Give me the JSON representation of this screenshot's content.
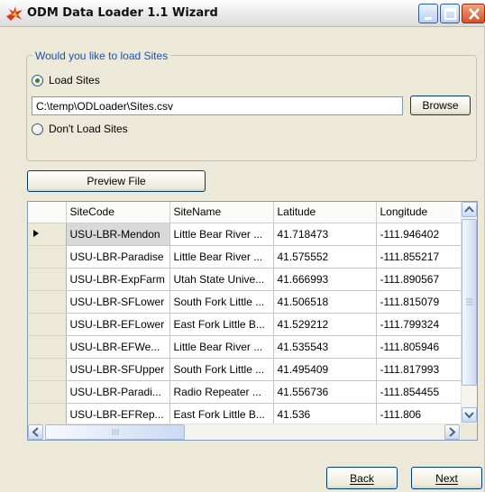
{
  "window": {
    "title": "ODM Data Loader 1.1 Wizard"
  },
  "group": {
    "legend": "Would you like to load Sites",
    "load_option": "Load Sites",
    "file_path": "C:\\temp\\ODLoader\\Sites.csv",
    "browse_label": "Browse",
    "dont_load_option": "Don't Load Sites"
  },
  "preview_label": "Preview File",
  "grid": {
    "columns": [
      "SiteCode",
      "SiteName",
      "Latitude",
      "Longitude"
    ],
    "rows": [
      [
        "USU-LBR-Mendon",
        "Little Bear River ...",
        "41.718473",
        "-111.946402"
      ],
      [
        "USU-LBR-Paradise",
        "Little Bear River ...",
        "41.575552",
        "-111.855217"
      ],
      [
        "USU-LBR-ExpFarm",
        "Utah State Unive...",
        "41.666993",
        "-111.890567"
      ],
      [
        "USU-LBR-SFLower",
        "South Fork Little ...",
        "41.506518",
        "-111.815079"
      ],
      [
        "USU-LBR-EFLower",
        "East Fork Little B...",
        "41.529212",
        "-111.799324"
      ],
      [
        "USU-LBR-EFWe...",
        "Little Bear River ...",
        "41.535543",
        "-111.805946"
      ],
      [
        "USU-LBR-SFUpper",
        "South Fork Little ...",
        "41.495409",
        "-111.817993"
      ],
      [
        "USU-LBR-Paradi...",
        "Radio Repeater ...",
        "41.556736",
        "-111.854455"
      ],
      [
        "USU-LBR-EFRep...",
        "East Fork Little B...",
        "41.536",
        "-111.806"
      ]
    ]
  },
  "nav": {
    "back_label": "Back",
    "next_label": "Next"
  },
  "icons": {
    "app": "odm-logo-icon",
    "minimize": "minimize-icon",
    "maximize": "maximize-icon",
    "close": "close-icon"
  }
}
